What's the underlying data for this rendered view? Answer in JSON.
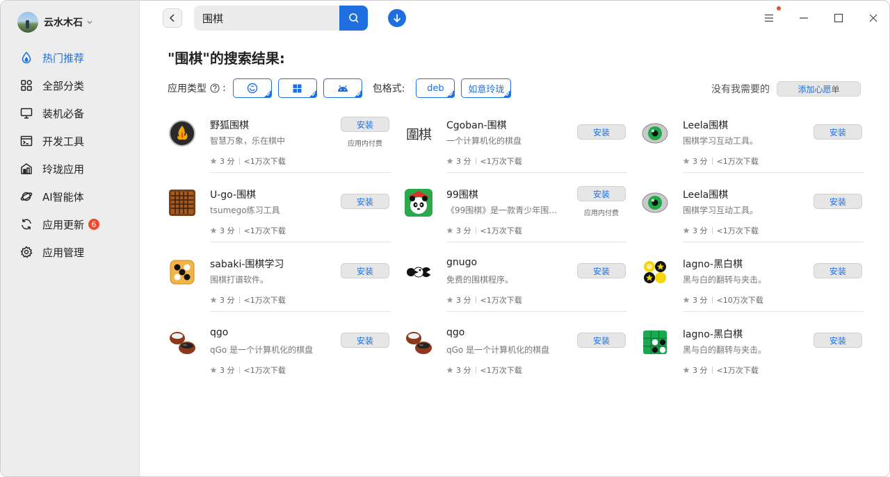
{
  "user": {
    "name": "云水木石"
  },
  "nav": [
    {
      "id": "hot",
      "label": "热门推荐",
      "icon": "drop-icon",
      "active": true
    },
    {
      "id": "all",
      "label": "全部分类",
      "icon": "grid-icon"
    },
    {
      "id": "essential",
      "label": "装机必备",
      "icon": "monitor-icon"
    },
    {
      "id": "dev",
      "label": "开发工具",
      "icon": "terminal-icon"
    },
    {
      "id": "linglong",
      "label": "玲珑应用",
      "icon": "linglong-icon"
    },
    {
      "id": "ai",
      "label": "AI智能体",
      "icon": "ai-planet-icon"
    },
    {
      "id": "update",
      "label": "应用更新",
      "icon": "refresh-icon",
      "badge": "6"
    },
    {
      "id": "manage",
      "label": "应用管理",
      "icon": "gear-icon"
    }
  ],
  "search": {
    "value": "围棋",
    "placeholder": ""
  },
  "results": {
    "title": "\"围棋\"的搜索结果:",
    "app_type_label": "应用类型",
    "colon": ":",
    "package_label": "包格式:",
    "package_chips": [
      "deb",
      "如意玲珑"
    ],
    "wish_text": "没有我需要的",
    "wish_button": "添加心愿单"
  },
  "apps": [
    {
      "name": "野狐围棋",
      "desc": "智慧万象，乐在棋中",
      "rating": "3 分",
      "downloads": "<1万次下载",
      "install": "安装",
      "iap": "应用内付费",
      "icon": "foxwq-icon"
    },
    {
      "name": "Cgoban-围棋",
      "desc": "一个计算机化的棋盘",
      "rating": "3 分",
      "downloads": "<1万次下载",
      "install": "安装",
      "iap": "",
      "icon": "cgoban-icon",
      "icon_text": "圍棋"
    },
    {
      "name": "Leela围棋",
      "desc": "围棋学习互动工具。",
      "rating": "3 分",
      "downloads": "<1万次下载",
      "install": "安装",
      "iap": "",
      "icon": "leela-eye-icon"
    },
    {
      "name": "U-go-围棋",
      "desc": "tsumego练习工具",
      "rating": "3 分",
      "downloads": "<1万次下载",
      "install": "安装",
      "iap": "",
      "icon": "ugo-board-icon"
    },
    {
      "name": "99围棋",
      "desc": "《99围棋》是一款青少年围棋…",
      "rating": "3 分",
      "downloads": "<1万次下载",
      "install": "安装",
      "iap": "应用内付费",
      "icon": "panda-icon"
    },
    {
      "name": "Leela围棋",
      "desc": "围棋学习互动工具。",
      "rating": "3 分",
      "downloads": "<1万次下载",
      "install": "安装",
      "iap": "",
      "icon": "leela-eye-icon"
    },
    {
      "name": "sabaki-围棋学习",
      "desc": "围棋打谱软件。",
      "rating": "3 分",
      "downloads": "<1万次下载",
      "install": "安装",
      "iap": "",
      "icon": "sabaki-icon"
    },
    {
      "name": "gnugo",
      "desc": "免费的围棋程序。",
      "rating": "3 分",
      "downloads": "<1万次下载",
      "install": "安装",
      "iap": "",
      "icon": "gnugo-icon"
    },
    {
      "name": "lagno-黑白棋",
      "desc": "黑与白的翻转与夹击。",
      "rating": "3 分",
      "downloads": "<10万次下载",
      "install": "安装",
      "iap": "",
      "icon": "lagno-stars-icon"
    },
    {
      "name": "qgo",
      "desc": "qGo 是一个计算机化的棋盘",
      "rating": "3 分",
      "downloads": "<1万次下载",
      "install": "安装",
      "iap": "",
      "icon": "qgo-bowls-icon"
    },
    {
      "name": "qgo",
      "desc": "qGo 是一个计算机化的棋盘",
      "rating": "3 分",
      "downloads": "<1万次下载",
      "install": "安装",
      "iap": "",
      "icon": "qgo-bowls-icon"
    },
    {
      "name": "lagno-黑白棋",
      "desc": "黑与白的翻转与夹击。",
      "rating": "3 分",
      "downloads": "<1万次下载",
      "install": "安装",
      "iap": "",
      "icon": "lagno-board-icon"
    }
  ],
  "colors": {
    "accent": "#1f6fe0",
    "badge": "#f04a2a",
    "sidebar_bg": "#ededed"
  }
}
